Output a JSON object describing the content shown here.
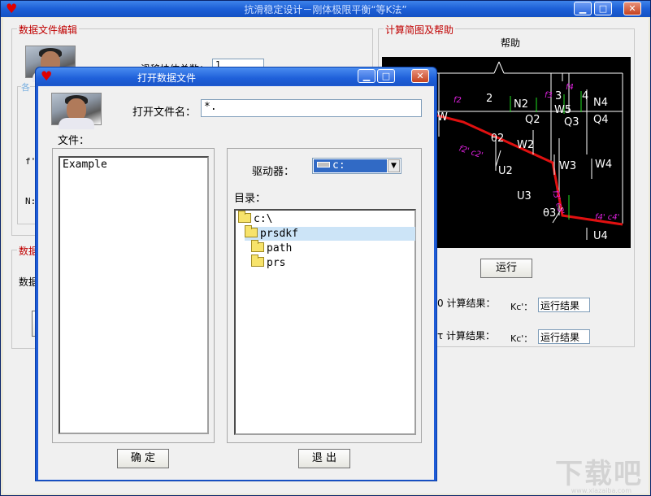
{
  "main": {
    "title": "抗滑稳定设计－刚体极限平衡“等K法”",
    "minimize_label": "▁",
    "maximize_label": "□",
    "close_label": "✕"
  },
  "left_group": {
    "title": "数据文件编辑",
    "slide_count_label": "滑移块体总数：",
    "slide_count_value": "1",
    "legend_partial": "各",
    "label_f": "f'",
    "label_n": "N:"
  },
  "left_group2": {
    "title": "数据",
    "row_label": "数据"
  },
  "right_group": {
    "title": "计算简图及帮助",
    "help_label": "帮助",
    "run_button": "运行",
    "result1_label": "0 计算结果：",
    "result2_label": "τ 计算结果：",
    "kc_label1": "Kc'：",
    "kc_label2": "Kc'：",
    "result1_value": "运行结果",
    "result2_value": "运行结果"
  },
  "diagram": {
    "labels": [
      "2",
      "3",
      "4",
      "N2",
      "Q2",
      "W5",
      "Q3",
      "N4",
      "Q4",
      "W2",
      "U2",
      "W3",
      "W4",
      "U3",
      "U4",
      "θ2",
      "θ3",
      "f2",
      "f3",
      "f4",
      "f2' c2'",
      "f4' c4'",
      "W"
    ],
    "colors": {
      "slip_line": "#e01010",
      "forces": "#ffffff",
      "normals": "#20e020",
      "annotations": "#e020e0"
    }
  },
  "dialog": {
    "title": "打开数据文件",
    "filename_label": "打开文件名：",
    "filename_value": "*.",
    "files_label": "文件：",
    "files": [
      "Example"
    ],
    "drive_label": "驱动器：",
    "drive_value": "c:",
    "dir_label": "目录：",
    "dirs": [
      {
        "name": "c:\\",
        "level": 0,
        "open": true,
        "selected": false
      },
      {
        "name": "prsdkf",
        "level": 1,
        "open": true,
        "selected": true
      },
      {
        "name": "path",
        "level": 2,
        "open": false,
        "selected": false
      },
      {
        "name": "prs",
        "level": 2,
        "open": false,
        "selected": false
      }
    ],
    "ok_button": "确 定",
    "exit_button": "退 出"
  },
  "watermark": {
    "text": "下载吧",
    "sub": "www.xiazaiba.com"
  }
}
